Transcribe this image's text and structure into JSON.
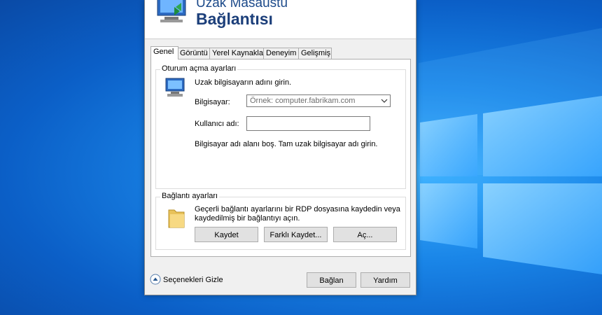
{
  "dialog": {
    "title_line1": "Uzak Masaüstü",
    "title_line2": "Bağlantısı"
  },
  "tabs": [
    {
      "label": "Genel",
      "active": true
    },
    {
      "label": "Görüntü"
    },
    {
      "label": "Yerel Kaynaklar"
    },
    {
      "label": "Deneyim"
    },
    {
      "label": "Gelişmiş"
    }
  ],
  "logon": {
    "group_label": "Oturum açma ayarları",
    "instruction": "Uzak bilgisayarın adını girin.",
    "computer_label": "Bilgisayar:",
    "computer_placeholder": "Örnek: computer.fabrikam.com",
    "username_label": "Kullanıcı adı:",
    "username_value": "",
    "error_text": "Bilgisayar adı alanı boş. Tam uzak bilgisayar adı girin."
  },
  "connection": {
    "group_label": "Bağlantı ayarları",
    "description_line1": "Geçerli bağlantı ayarlarını bir RDP dosyasına kaydedin veya",
    "description_line2": "kaydedilmiş bir bağlantıyı açın.",
    "save_label": "Kaydet",
    "save_as_label": "Farklı Kaydet...",
    "open_label": "Aç..."
  },
  "footer": {
    "hide_options_label": "Seçenekleri Gizle",
    "connect_label": "Bağlan",
    "help_label": "Yardım"
  },
  "colors": {
    "accent": "#0078d7",
    "title_text": "#1c3f7a",
    "desktop": "#1a86e8"
  }
}
